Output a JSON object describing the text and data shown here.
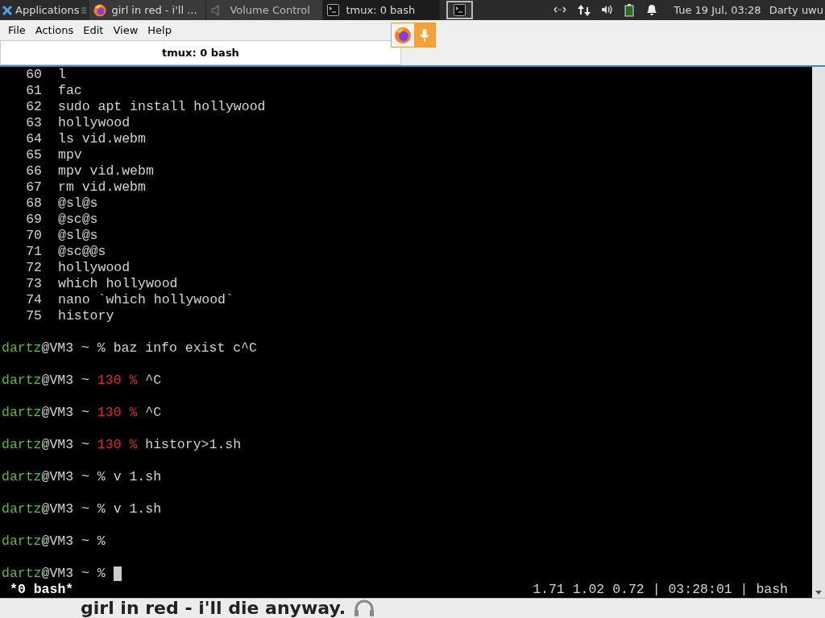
{
  "panel": {
    "launcher": "Applications",
    "windows": [
      {
        "kind": "firefox",
        "label": "girl in red - i'll ...",
        "selected": false
      },
      {
        "kind": "volume",
        "label": "Volume Control",
        "selected": false
      },
      {
        "kind": "terminal",
        "label": "tmux: 0 bash",
        "selected": true
      }
    ],
    "clock": "Tue 19 Jul, 03:28",
    "user": "Darty uwu"
  },
  "menu": [
    "File",
    "Actions",
    "Edit",
    "View",
    "Help"
  ],
  "tab": {
    "title": "tmux: 0 bash",
    "selected": true
  },
  "terminal": {
    "lines": [
      {
        "kind": "history",
        "number": "60",
        "command": "l"
      },
      {
        "kind": "history",
        "number": "61",
        "command": "fac"
      },
      {
        "kind": "history",
        "number": "62",
        "command": "sudo apt install hollywood"
      },
      {
        "kind": "history",
        "number": "63",
        "command": "hollywood"
      },
      {
        "kind": "history",
        "number": "64",
        "command": "ls vid.webm"
      },
      {
        "kind": "history",
        "number": "65",
        "command": "mpv"
      },
      {
        "kind": "history",
        "number": "66",
        "command": "mpv vid.webm"
      },
      {
        "kind": "history",
        "number": "67",
        "command": "rm vid.webm"
      },
      {
        "kind": "history",
        "number": "68",
        "command": "@sl@s"
      },
      {
        "kind": "history",
        "number": "69",
        "command": "@sc@s"
      },
      {
        "kind": "history",
        "number": "70",
        "command": "@sl@s"
      },
      {
        "kind": "history",
        "number": "71",
        "command": "@sc@@s"
      },
      {
        "kind": "history",
        "number": "72",
        "command": "hollywood"
      },
      {
        "kind": "history",
        "number": "73",
        "command": "which hollywood"
      },
      {
        "kind": "history",
        "number": "74",
        "command": "nano `which hollywood`"
      },
      {
        "kind": "history",
        "number": "75",
        "command": "history"
      },
      {
        "kind": "blank"
      },
      {
        "kind": "prompt",
        "user": "dartz",
        "host": "@VM3 ~",
        "symbol": "%",
        "command": "baz info exist c^C"
      },
      {
        "kind": "blank"
      },
      {
        "kind": "prompt",
        "user": "dartz",
        "host": "@VM3 ~",
        "symbol": "130 %",
        "error": true,
        "command": "^C"
      },
      {
        "kind": "blank"
      },
      {
        "kind": "prompt",
        "user": "dartz",
        "host": "@VM3 ~",
        "symbol": "130 %",
        "error": true,
        "command": "^C"
      },
      {
        "kind": "blank"
      },
      {
        "kind": "prompt",
        "user": "dartz",
        "host": "@VM3 ~",
        "symbol": "130 %",
        "error": true,
        "command": "history>1.sh"
      },
      {
        "kind": "blank"
      },
      {
        "kind": "prompt",
        "user": "dartz",
        "host": "@VM3 ~",
        "symbol": "%",
        "command": "v 1.sh"
      },
      {
        "kind": "blank"
      },
      {
        "kind": "prompt",
        "user": "dartz",
        "host": "@VM3 ~",
        "symbol": "%",
        "command": "v 1.sh"
      },
      {
        "kind": "blank"
      },
      {
        "kind": "prompt",
        "user": "dartz",
        "host": "@VM3 ~",
        "symbol": "%"
      },
      {
        "kind": "blank"
      },
      {
        "kind": "prompt",
        "user": "dartz",
        "host": "@VM3 ~",
        "symbol": "%",
        "cursor": true
      }
    ],
    "status_left": "*0 bash*",
    "status_right": "1.71 1.02 0.72 | 03:28:01 | bash"
  },
  "now_playing": "girl in red - i'll die anyway."
}
